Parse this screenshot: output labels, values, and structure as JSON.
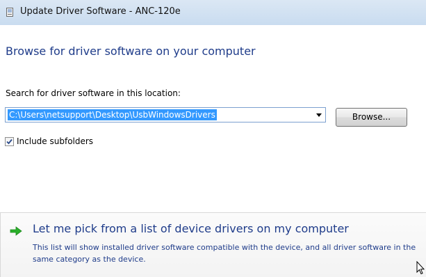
{
  "window": {
    "title": "Update Driver Software - ANC-120e"
  },
  "page": {
    "heading": "Browse for driver software on your computer",
    "search_label": "Search for driver software in this location:"
  },
  "path_field": {
    "value": "C:\\Users\\netsupport\\Desktop\\UsbWindowsDrivers",
    "selected": true
  },
  "browse_button": {
    "label": "Browse..."
  },
  "include_subfolders": {
    "label": "Include subfolders",
    "checked": true
  },
  "pick_option": {
    "title": "Let me pick from a list of device drivers on my computer",
    "description": "This list will show installed driver software compatible with the device, and all driver software in the same category as the device."
  },
  "icons": {
    "window": "device-icon",
    "dropdown": "chevron-down-icon",
    "option": "green-arrow-icon",
    "cursor": "mouse-cursor-icon"
  },
  "colors": {
    "heading": "#1f3c8a",
    "selection": "#3399ff",
    "arrow": "#2bb02b"
  }
}
